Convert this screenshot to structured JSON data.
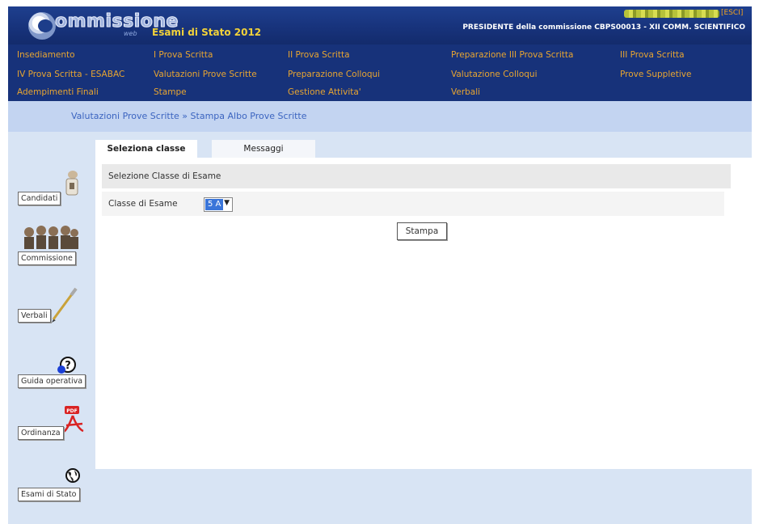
{
  "header": {
    "logo_text": "ommissione",
    "logo_suffix": "web",
    "app_title": "Esami di Stato 2012",
    "logout_label": "[ESCI]",
    "president_line": "PRESIDENTE della commissione CBPS00013 - XII COMM. SCIENTIFICO"
  },
  "menu": {
    "row1": [
      "Insediamento",
      "I Prova Scritta",
      "II Prova Scritta",
      "Preparazione III Prova Scritta",
      "III Prova Scritta"
    ],
    "row2": [
      "IV Prova Scritta - ESABAC",
      "Valutazioni Prove Scritte",
      "Preparazione Colloqui",
      "Valutazione Colloqui",
      "Prove Suppletive"
    ],
    "row3": [
      "Adempimenti Finali",
      "Stampe",
      "Gestione Attivita'",
      "Verbali"
    ]
  },
  "breadcrumb": "Valutazioni Prove Scritte » Stampa Albo Prove Scritte",
  "sidebar": {
    "items": [
      {
        "label": "Candidati",
        "icon": "candidati-icon"
      },
      {
        "label": "Commissione",
        "icon": "commissione-icon"
      },
      {
        "label": "Verbali",
        "icon": "pen-icon"
      },
      {
        "label": "Guida operativa",
        "icon": "help-icon"
      },
      {
        "label": "Ordinanza",
        "icon": "pdf-icon"
      },
      {
        "label": "Esami di Stato",
        "icon": "globe-icon"
      }
    ]
  },
  "tabs": [
    "Seleziona classe",
    "Messaggi"
  ],
  "form": {
    "section_title": "Selezione Classe di Esame",
    "classe_label": "Classe di Esame",
    "classe_value": "5 A",
    "print_button": "Stampa"
  },
  "colors": {
    "header_blue": "#17327a",
    "menu_text": "#e8a531",
    "title_yellow": "#f2d23a",
    "breadcrumb_bg": "#c3d4f1",
    "selected_option": "#3a75d9"
  }
}
